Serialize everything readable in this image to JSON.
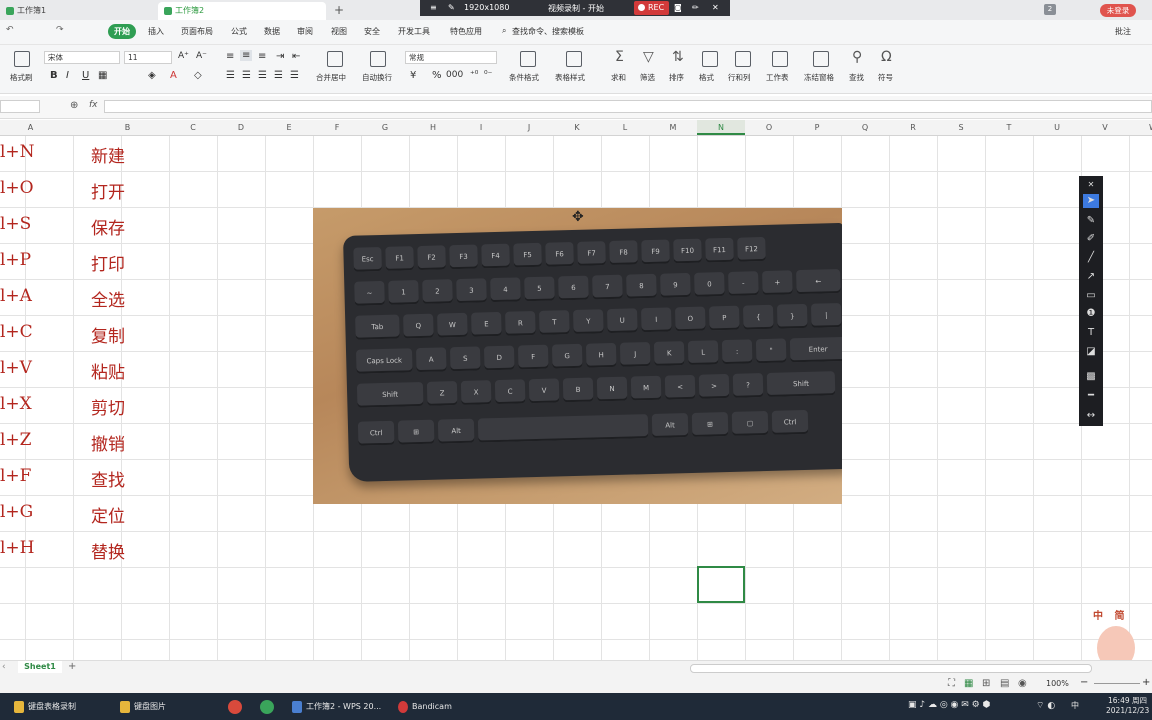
{
  "titlebar": {
    "tab1": "工作簿1",
    "tab2": "工作簿2",
    "add_tab": "+",
    "resolution": "1920x1080",
    "recording_status": "视频录制 - 开始",
    "rec": "REC",
    "page_count": "2",
    "login": "未登录"
  },
  "menu": {
    "start": "开始",
    "items": [
      "插入",
      "页面布局",
      "公式",
      "数据",
      "审阅",
      "视图",
      "安全",
      "开发工具",
      "特色应用"
    ],
    "search": "查找命令、搜索模板",
    "annotation": "批注"
  },
  "toolbar": {
    "format_painter": "格式刷",
    "font_name": "宋体",
    "font_size": "11",
    "bold": "B",
    "italic": "I",
    "underline": "U",
    "merge": "合并居中",
    "wrap": "自动换行",
    "number_format": "常规",
    "percent": "%",
    "conditional": "条件格式",
    "table_style": "表格样式",
    "sum": "求和",
    "filter": "筛选",
    "sort": "排序",
    "format": "格式",
    "rows_cols": "行和列",
    "worksheet": "工作表",
    "freeze": "冻结窗格",
    "find": "查找",
    "symbol": "符号"
  },
  "formula": {
    "fx": "fx",
    "value": ""
  },
  "columns": [
    "A",
    "B",
    "C",
    "D",
    "E",
    "F",
    "G",
    "H",
    "I",
    "J",
    "K",
    "L",
    "M",
    "N",
    "O",
    "P",
    "Q",
    "R",
    "S",
    "T",
    "U",
    "V",
    "W"
  ],
  "selected_column": "N",
  "rows": [
    {
      "a": "l+N",
      "b": "新建"
    },
    {
      "a": "l+O",
      "b": "打开"
    },
    {
      "a": "l+S",
      "b": "保存"
    },
    {
      "a": "l+P",
      "b": "打印"
    },
    {
      "a": "l+A",
      "b": "全选"
    },
    {
      "a": "l+C",
      "b": "复制"
    },
    {
      "a": "l+V",
      "b": "粘贴"
    },
    {
      "a": "l+X",
      "b": "剪切"
    },
    {
      "a": "l+Z",
      "b": "撤销"
    },
    {
      "a": "l+F",
      "b": "查找"
    },
    {
      "a": "l+G",
      "b": "定位"
    },
    {
      "a": "l+H",
      "b": "替换"
    }
  ],
  "keyboard_rows": [
    [
      "Esc",
      "F1",
      "F2",
      "F3",
      "F4",
      "F5",
      "F6",
      "F7",
      "F8",
      "F9",
      "F10",
      "F11",
      "F12"
    ],
    [
      "~",
      "1",
      "2",
      "3",
      "4",
      "5",
      "6",
      "7",
      "8",
      "9",
      "0",
      "-",
      "+",
      "←"
    ],
    [
      "Tab",
      "Q",
      "W",
      "E",
      "R",
      "T",
      "Y",
      "U",
      "I",
      "O",
      "P",
      "{",
      "}",
      "|"
    ],
    [
      "Caps Lock",
      "A",
      "S",
      "D",
      "F",
      "G",
      "H",
      "J",
      "K",
      "L",
      ":",
      "\"",
      "Enter"
    ],
    [
      "Shift",
      "Z",
      "X",
      "C",
      "V",
      "B",
      "N",
      "M",
      "<",
      ">",
      "?",
      "Shift"
    ],
    [
      "Ctrl",
      "⊞",
      "Alt",
      "",
      "Alt",
      "⊞",
      "▢",
      "Ctrl"
    ]
  ],
  "sheet": {
    "tab": "Sheet1",
    "add": "+"
  },
  "status": {
    "zoom": "100%"
  },
  "watermark": "中 简",
  "taskbar": {
    "items": [
      "键盘表格录制",
      "键盘图片",
      "工作簿2 - WPS 20...",
      "Bandicam"
    ],
    "time": "16:49 周四",
    "date": "2021/12/23",
    "ime": "中"
  },
  "colors": {
    "accent": "#2f8a45",
    "text_red": "#b3261e",
    "rec": "#d23a3a"
  }
}
